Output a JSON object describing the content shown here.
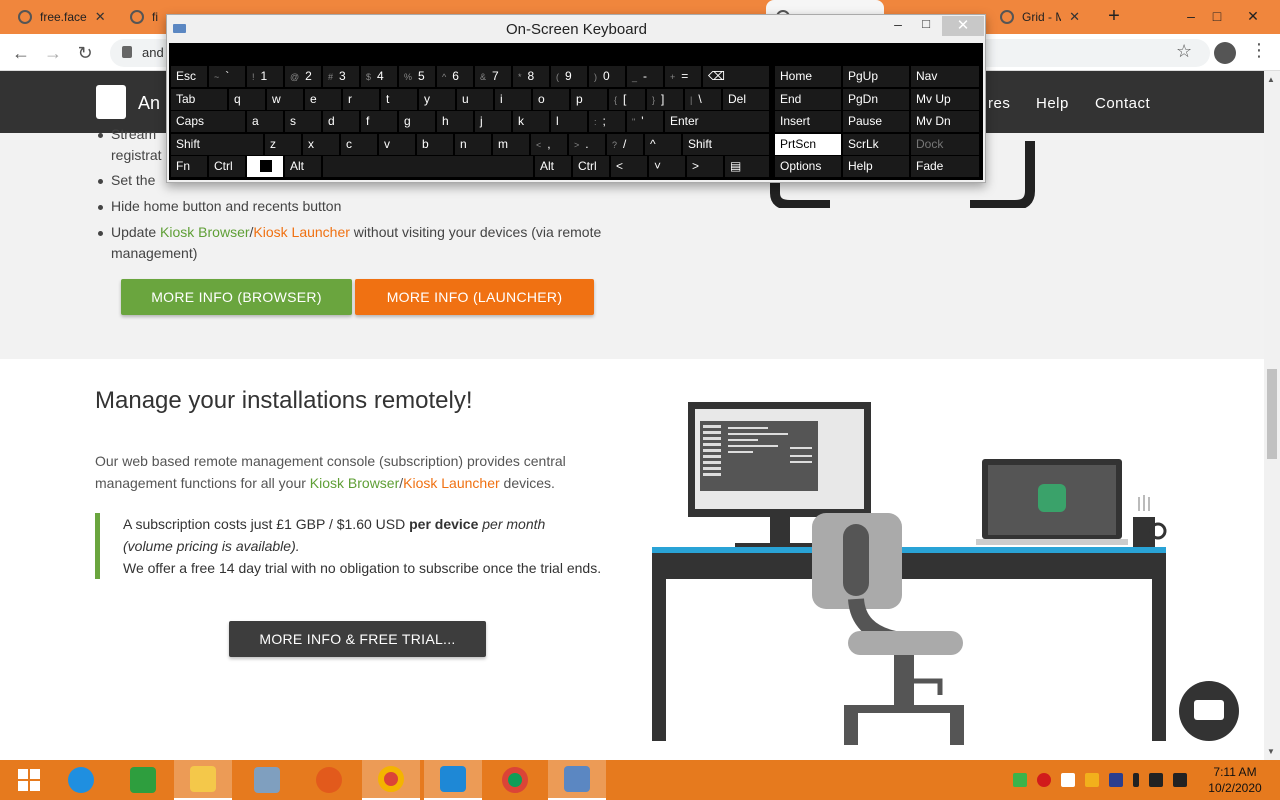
{
  "browser": {
    "tabs": [
      {
        "title": "free.face",
        "active": false
      },
      {
        "title": "fi",
        "active": false
      },
      {
        "title": "",
        "active": false
      },
      {
        "title": "",
        "active": false
      },
      {
        "title": "",
        "active": false
      },
      {
        "title": "",
        "active": false
      },
      {
        "title": "",
        "active": true
      },
      {
        "title": "",
        "active": false
      },
      {
        "title": "Grid - M",
        "active": false
      }
    ],
    "url": "and",
    "new_tab": "+",
    "minimize": "–",
    "maximize": "□",
    "close": "✕"
  },
  "site": {
    "logo_text": "An",
    "nav": [
      "res",
      "Help",
      "Contact"
    ],
    "bullets": [
      {
        "text": "Stream",
        "continued": false
      },
      {
        "text": "registrat",
        "continued": true
      },
      {
        "text": "Set the",
        "continued": false
      },
      {
        "text": "Hide home button and recents button",
        "continued": false
      }
    ],
    "update_bullet": {
      "prefix": "Update ",
      "browser": "Kiosk Browser",
      "slash": "/",
      "launcher": "Kiosk Launcher",
      "suffix": " without visiting your devices (via remote management)"
    },
    "btn_browser": "MORE INFO (BROWSER)",
    "btn_launcher": "MORE INFO (LAUNCHER)",
    "heading": "Manage your installations remotely!",
    "para": {
      "prefix": "Our web based remote management console (subscription) provides central management functions for all your ",
      "browser": "Kiosk Browser",
      "slash": "/",
      "launcher": "Kiosk Launcher",
      "suffix": " devices."
    },
    "quote": {
      "line1_a": "A subscription costs just £1 GBP / $1.60 USD ",
      "line1_b": "per device",
      "line1_c": " per month",
      "line2": "(volume pricing is available).",
      "line3": "We offer a free 14 day trial with no obligation to subscribe once the trial ends."
    },
    "btn_trial": "MORE INFO & FREE TRIAL..."
  },
  "osk": {
    "title": "On-Screen Keyboard",
    "keys": {
      "esc": "Esc",
      "tab": "Tab",
      "caps": "Caps",
      "shift": "Shift",
      "fn": "Fn",
      "ctrl": "Ctrl",
      "alt": "Alt",
      "del": "Del",
      "enter": "Enter",
      "home": "Home",
      "pgup": "PgUp",
      "nav": "Nav",
      "end": "End",
      "pgdn": "PgDn",
      "mvup": "Mv Up",
      "insert": "Insert",
      "pause": "Pause",
      "mvdn": "Mv Dn",
      "prtscn": "PrtScn",
      "scrlk": "ScrLk",
      "dock": "Dock",
      "options": "Options",
      "help": "Help",
      "fade": "Fade"
    }
  },
  "taskbar": {
    "clock_time": "7:11 AM",
    "clock_date": "10/2/2020"
  },
  "colors": {
    "orange": "#f07112",
    "green": "#6aa53e",
    "dark": "#333333",
    "taskbar": "#e67a1e"
  }
}
